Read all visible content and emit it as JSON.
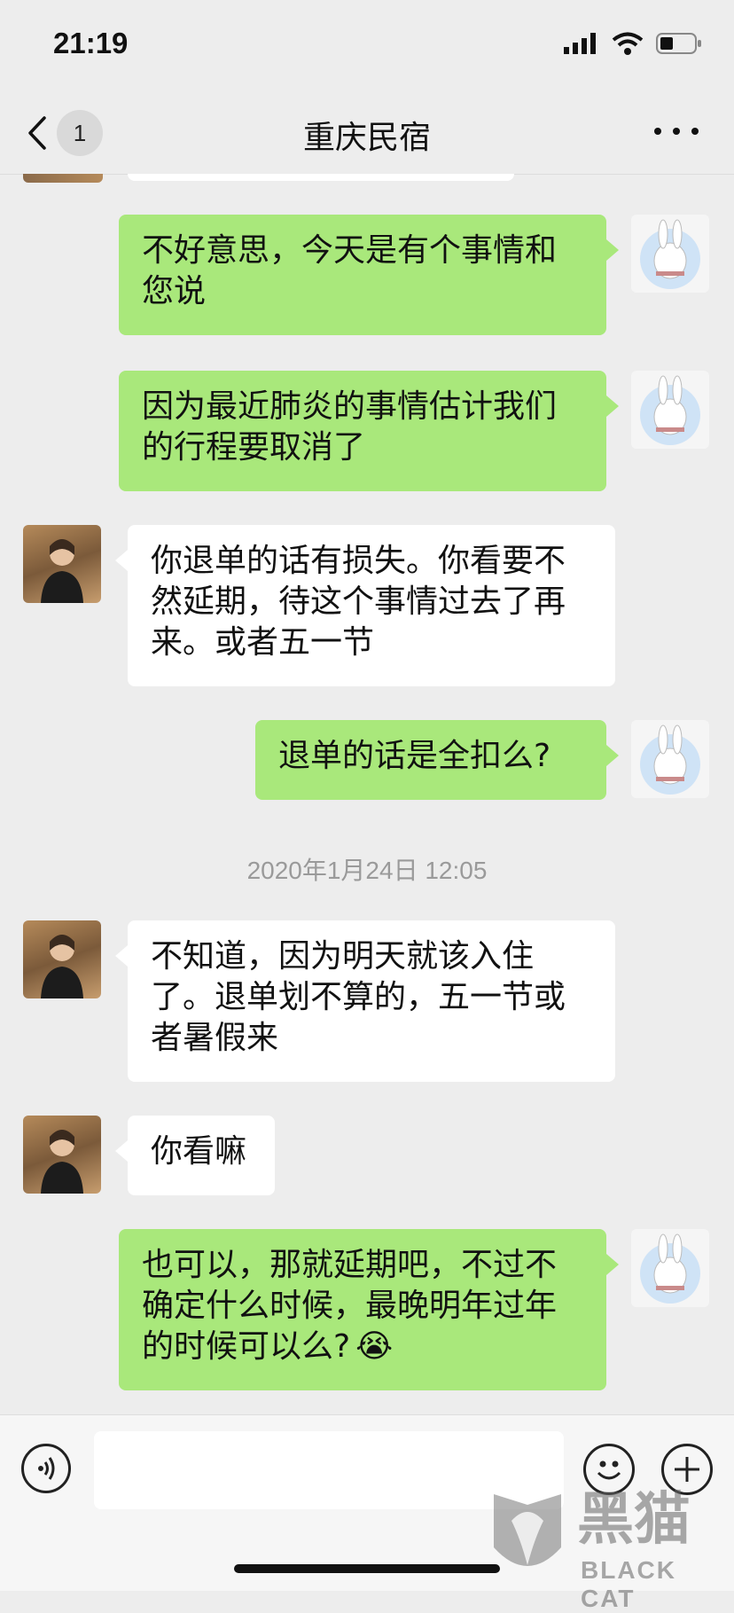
{
  "status_bar": {
    "time": "21:19",
    "icons": [
      "signal-icon",
      "wifi-icon",
      "battery-icon"
    ]
  },
  "nav": {
    "back_badge": "1",
    "title": "重庆民宿",
    "more_icon": "more-icon"
  },
  "messages": [
    {
      "from": "self",
      "text": "不好意思，今天是有个事情和您说"
    },
    {
      "from": "self",
      "text": "因为最近肺炎的事情估计我们的行程要取消了"
    },
    {
      "from": "other",
      "text": "你退单的话有损失。你看要不然延期，待这个事情过去了再来。或者五一节"
    },
    {
      "from": "self",
      "text": "退单的话是全扣么?"
    },
    {
      "from": "other",
      "text": "不知道，因为明天就该入住了。退单划不算的，五一节或者暑假来"
    },
    {
      "from": "other",
      "text": "你看嘛"
    },
    {
      "from": "self",
      "text": "也可以，那就延期吧，不过不确定什么时候，最晚明年过年的时候可以么?",
      "emoji": "😭"
    }
  ],
  "timestamp": "2020年1月24日 12:05",
  "input": {
    "value": "",
    "placeholder": ""
  },
  "watermark": {
    "brand_cn": "黑猫",
    "brand_en": "BLACK CAT"
  },
  "colors": {
    "self_bubble": "#a9e87b",
    "other_bubble": "#ffffff",
    "background": "#ededed"
  }
}
